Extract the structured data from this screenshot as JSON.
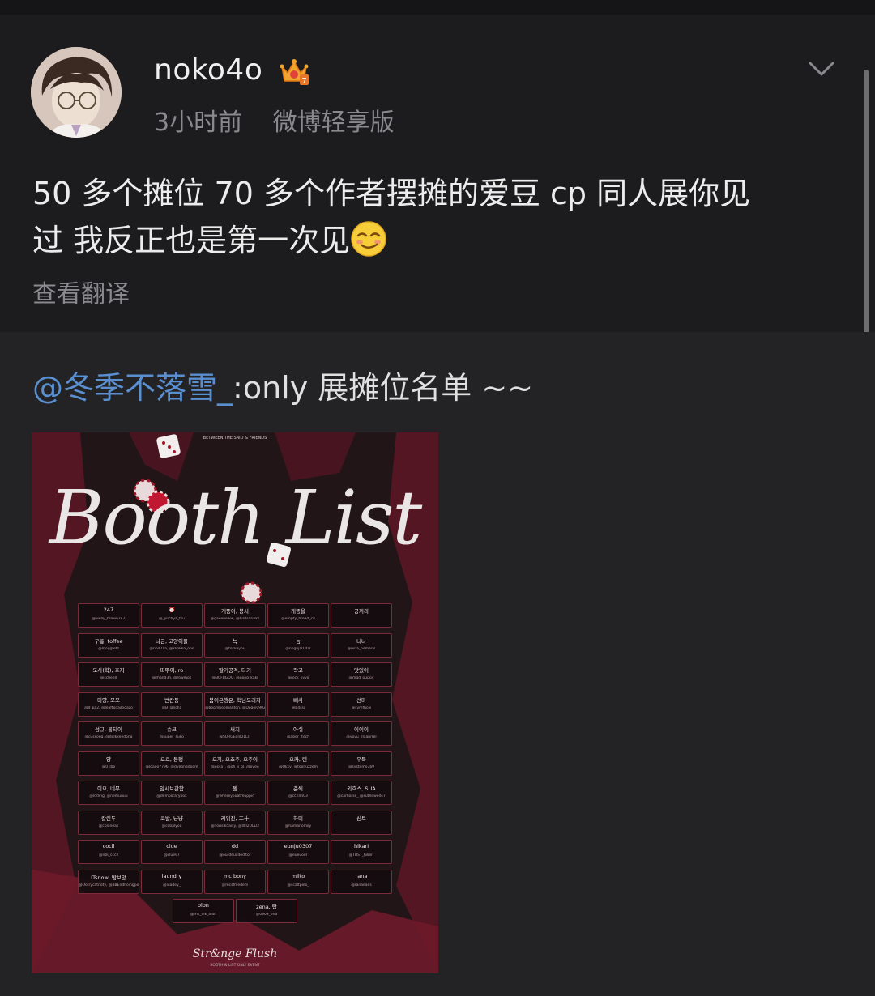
{
  "post": {
    "username": "noko4o",
    "time": "3小时前",
    "source": "微博轻享版",
    "text_line1": "50 多个摊位 70 多个作者摆摊的爱豆 cp 同人展你见",
    "text_line2": "过 我反正也是第一次见",
    "translate_label": "查看翻译"
  },
  "repost": {
    "mention": "@冬季不落雪_",
    "text": ":only 展摊位名单 ~~"
  },
  "poster": {
    "top_text": "BETWEEN THE SAID & FRIENDS",
    "title": "Booth List",
    "footer": "Str&nge Flush",
    "footer_sub": "BOOTH & LIST ONLY EVENT",
    "booths": [
      {
        "name": "247",
        "handle": "@welly_brown247"
      },
      {
        "name": "⏰",
        "handle": "@_jinchya_tsu"
      },
      {
        "name": "개똥이, 봉서",
        "handle": "@gaeeeeww, @birdsdrinks"
      },
      {
        "name": "개똥을",
        "handle": "@empty_bread_cv"
      },
      {
        "name": "공끼리",
        "handle": ""
      },
      {
        "name": "구름, toffee",
        "handle": "@moggfetz"
      },
      {
        "name": "나금, 고양이풀",
        "handle": "@nod71a, @kkokko_ooo"
      },
      {
        "name": "녹",
        "handle": "@tokkeyou"
      },
      {
        "name": "늠",
        "handle": "@noguja0302"
      },
      {
        "name": "니나",
        "handle": "@nina_nemeris"
      },
      {
        "name": "도사(학), 호지",
        "handle": "@scheell"
      },
      {
        "name": "떠뿌이, ro",
        "handle": "@rhand3n, @rowmos"
      },
      {
        "name": "딸기공격, 타키",
        "handle": "@BCFBGOO, @gong_kaki"
      },
      {
        "name": "락고",
        "handle": "@rock_kyyo"
      },
      {
        "name": "맛있어",
        "handle": "@mgd_puppy"
      },
      {
        "name": "미양, 모모",
        "handle": "@d_pa2, @leaftodailogazo"
      },
      {
        "name": "번칸등",
        "handle": "@B_lancha"
      },
      {
        "name": "붐이은행운, 혁님도리자",
        "handle": "@boomboomanton, @Dogei0902"
      },
      {
        "name": "빼사",
        "handle": "@b4ssj"
      },
      {
        "name": "선마",
        "handle": "@symfhcoi"
      },
      {
        "name": "성규, 롱티이",
        "handle": "@cussong, @dolkkeedong"
      },
      {
        "name": "슈크",
        "handle": "@super_suko"
      },
      {
        "name": "써지",
        "handle": "@SURGEonKILLIT"
      },
      {
        "name": "아쉬",
        "handle": "@aber_ltech"
      },
      {
        "name": "이이이",
        "handle": "@yoyu_lllaanrrel"
      },
      {
        "name": "양",
        "handle": "@0_l0o"
      },
      {
        "name": "오로, 동행",
        "handle": "@loaoo7796, @dyeongdoom"
      },
      {
        "name": "오지, 오죠주, 오주이",
        "handle": "@ossa_, @oh_jj_ol, @oyeo"
      },
      {
        "name": "오카, 텐",
        "handle": "@Okky, @toolfuzzem"
      },
      {
        "name": "우득",
        "handle": "@systemo769"
      },
      {
        "name": "이요, 네무",
        "handle": "@ldding, @nemuuuu"
      },
      {
        "name": "임시보관함",
        "handle": "@demporarybox"
      },
      {
        "name": "젬",
        "handle": "@whereyouatmuppid"
      },
      {
        "name": "춘씩",
        "handle": "@cchlm03"
      },
      {
        "name": "키호스, SUA",
        "handle": "@carhorse_ @suthewell47"
      },
      {
        "name": "칼린두",
        "handle": "@cplaneas"
      },
      {
        "name": "코발, 냥냥",
        "handle": "@cobalyou"
      },
      {
        "name": "키위진, 二十",
        "handle": "@norisikdaisy, @lllll2ULLl2"
      },
      {
        "name": "하미",
        "handle": "@hamanomily"
      },
      {
        "name": "신토",
        "handle": ""
      },
      {
        "name": "cocll",
        "handle": "@ntk_cccll"
      },
      {
        "name": "clue",
        "handle": "@clue97"
      },
      {
        "name": "dd",
        "handle": "@ourdeuxdeditor"
      },
      {
        "name": "eunju0307",
        "handle": "@eueuoor"
      },
      {
        "name": "hikari",
        "handle": "@TBST_hikeri"
      },
      {
        "name": "ITsnow, 밤보앙",
        "handle": "@Ootrycatnoty, @BBEndhoingpot1"
      },
      {
        "name": "laundry",
        "handle": "@luadey_"
      },
      {
        "name": "mc bony",
        "handle": "@mcsfmedem"
      },
      {
        "name": "milto",
        "handle": "@scaltpelo_"
      },
      {
        "name": "rana",
        "handle": "@ranaeaes"
      },
      {
        "name": "olon",
        "handle": "@mk_olk_olon"
      },
      {
        "name": "zena, 탑",
        "handle": "@0909_ena"
      }
    ]
  },
  "colors": {
    "background": "#1c1c1e",
    "repost_bg": "#232326",
    "mention": "#5a8fd0",
    "muted": "#8a8a8e",
    "poster_red": "#6e1a2a"
  },
  "icons": {
    "crown": "vip-crown-icon",
    "chevron": "chevron-down-icon",
    "emoji": "smirk-emoji-icon"
  }
}
